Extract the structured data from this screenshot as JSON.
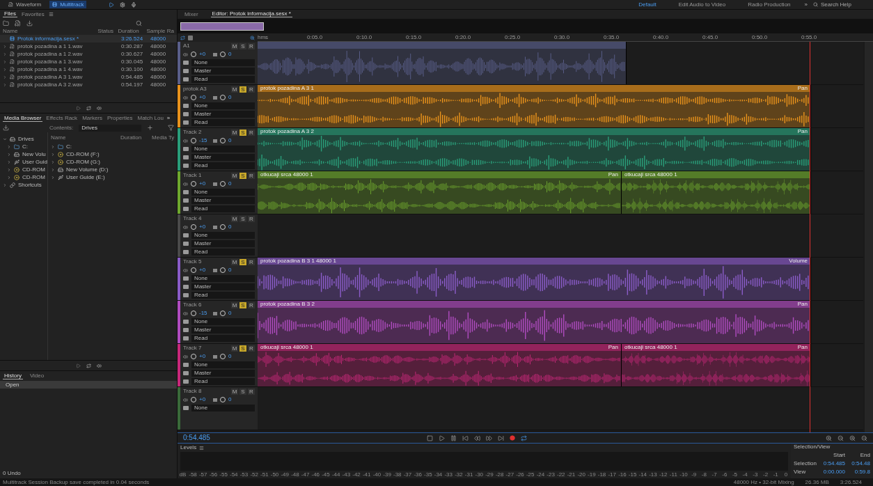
{
  "workspace_tabs": [
    {
      "label": "Waveform",
      "selected": false
    },
    {
      "label": "Multitrack",
      "selected": true
    }
  ],
  "workspaces": [
    {
      "label": "Default",
      "selected": true
    },
    {
      "label": "Edit Audio to Video",
      "selected": false
    },
    {
      "label": "Radio Production",
      "selected": false
    }
  ],
  "more": "»",
  "search": {
    "placeholder": "Search Help"
  },
  "files": {
    "tabs": [
      {
        "label": "Files",
        "selected": true
      },
      {
        "label": "Favorites",
        "selected": false
      }
    ],
    "columns": [
      "Name",
      "Status",
      "Duration",
      "Sample Ra"
    ],
    "rows": [
      {
        "name": "Protok informacija.sesx *",
        "duration": "3:26.524",
        "rate": "48000",
        "kind": "session",
        "selected": true
      },
      {
        "name": "protok pozadina a 1 1.wav",
        "duration": "0:30.287",
        "rate": "48000",
        "kind": "audio",
        "selected": false
      },
      {
        "name": "protok pozadina a 1 2.wav",
        "duration": "0:30.627",
        "rate": "48000",
        "kind": "audio",
        "selected": false
      },
      {
        "name": "protok pozadina a 1 3.wav",
        "duration": "0:30.045",
        "rate": "48000",
        "kind": "audio",
        "selected": false
      },
      {
        "name": "protok pozadina a 1 4.wav",
        "duration": "0:30.100",
        "rate": "48000",
        "kind": "audio",
        "selected": false
      },
      {
        "name": "protok pozadina A 3 1.wav",
        "duration": "0:54.485",
        "rate": "48000",
        "kind": "audio",
        "selected": false
      },
      {
        "name": "protok pozadina A 3 2.wav",
        "duration": "0:54.197",
        "rate": "48000",
        "kind": "audio",
        "selected": false
      }
    ]
  },
  "media": {
    "tabs": [
      {
        "label": "Media Browser",
        "selected": true
      },
      {
        "label": "Effects Rack",
        "selected": false
      },
      {
        "label": "Markers",
        "selected": false
      },
      {
        "label": "Properties",
        "selected": false
      },
      {
        "label": "Match Lou",
        "selected": false
      }
    ],
    "more": "»",
    "contents_label": "Contents:",
    "contents_value": "Drives",
    "tree": [
      {
        "label": "Drives",
        "kind": "drive",
        "expanded": true,
        "children": [
          {
            "label": "C:",
            "kind": "folder"
          },
          {
            "label": "New Volu",
            "kind": "drive"
          },
          {
            "label": "User Guid",
            "kind": "usb"
          },
          {
            "label": "CD-ROM",
            "kind": "cd"
          },
          {
            "label": "CD-ROM",
            "kind": "cd"
          }
        ]
      },
      {
        "label": "Shortcuts",
        "kind": "shortcut",
        "expanded": false
      }
    ],
    "columns": [
      "Name",
      "Duration",
      "Media Ty"
    ],
    "rows": [
      {
        "label": "C:",
        "kind": "folder"
      },
      {
        "label": "CD-ROM (F:)",
        "kind": "cd"
      },
      {
        "label": "CD-ROM (G:)",
        "kind": "cd"
      },
      {
        "label": "New Volume (D:)",
        "kind": "drive"
      },
      {
        "label": "User Guide (E:)",
        "kind": "usb"
      }
    ]
  },
  "history": {
    "tabs": [
      {
        "label": "History",
        "selected": true
      },
      {
        "label": "Video",
        "selected": false
      }
    ],
    "items": [
      {
        "label": "Open",
        "selected": true
      }
    ],
    "undo": "0 Undo"
  },
  "editor_tabs": [
    {
      "label": "Mixer",
      "selected": false
    },
    {
      "label": "Editor: Protok informacija.sesx *",
      "selected": true
    }
  ],
  "ruler": [
    "hms",
    "0:05.0",
    "0:10.0",
    "0:15.0",
    "0:20.0",
    "0:25.0",
    "0:30.0",
    "0:35.0",
    "0:40.0",
    "0:45.0",
    "0:50.0",
    "0:55.0"
  ],
  "tracks": [
    {
      "name": "A1",
      "color": "#5a5f8a",
      "buttons": [
        {
          "label": "M",
          "kind": "mute",
          "on": false
        },
        {
          "label": "S",
          "kind": "solo",
          "on": false
        },
        {
          "label": "R",
          "kind": "record",
          "on": false
        }
      ],
      "volume": "+0",
      "pan": "0",
      "input": "None",
      "output": "Master",
      "automation": "Read",
      "clips": [
        {
          "kind": "mono"
        }
      ]
    },
    {
      "name": "protok A3",
      "color": "#e8921c",
      "buttons": [
        {
          "label": "M",
          "kind": "mute",
          "on": false
        },
        {
          "label": "S",
          "kind": "solo",
          "on": true
        },
        {
          "label": "R",
          "kind": "record",
          "on": false
        }
      ],
      "volume": "+0",
      "pan": "0",
      "input": "None",
      "output": "Master",
      "automation": "Read",
      "clips": [
        {
          "name": "protok pozadina A 3 1",
          "label": "Pan",
          "kind": "stereo"
        }
      ]
    },
    {
      "name": "Track 2",
      "color": "#2a9e7a",
      "buttons": [
        {
          "label": "M",
          "kind": "mute",
          "on": false
        },
        {
          "label": "S",
          "kind": "solo",
          "on": true
        },
        {
          "label": "R",
          "kind": "record",
          "on": false
        }
      ],
      "volume": "-15",
      "pan": "0",
      "input": "None",
      "output": "Master",
      "automation": "Read",
      "clips": [
        {
          "name": "protok pozadina A 3 2",
          "label": "Pan",
          "kind": "stereo"
        }
      ]
    },
    {
      "name": "Track 1",
      "color": "#6fa82e",
      "buttons": [
        {
          "label": "M",
          "kind": "mute",
          "on": false
        },
        {
          "label": "S",
          "kind": "solo",
          "on": true
        },
        {
          "label": "R",
          "kind": "record",
          "on": false
        }
      ],
      "volume": "+0",
      "pan": "0",
      "input": "None",
      "output": "Master",
      "automation": "Read",
      "clips": [
        {
          "name": "otkucaji srca 48000 1",
          "label": "Pan",
          "kind": "stereo"
        },
        {
          "name": "otkucaji srca 48000 1",
          "kind": "stereo"
        }
      ]
    },
    {
      "name": "Track 4",
      "color": "#4a4a4a",
      "buttons": [
        {
          "label": "M",
          "kind": "mute",
          "on": false
        },
        {
          "label": "S",
          "kind": "solo",
          "on": false
        },
        {
          "label": "R",
          "kind": "record",
          "on": false
        }
      ],
      "volume": "+0",
      "pan": "0",
      "input": "None",
      "output": "Master",
      "automation": "Read"
    },
    {
      "name": "Track 5",
      "color": "#8a5cc8",
      "buttons": [
        {
          "label": "M",
          "kind": "mute",
          "on": false
        },
        {
          "label": "S",
          "kind": "solo",
          "on": true
        },
        {
          "label": "R",
          "kind": "record",
          "on": false
        }
      ],
      "volume": "+0",
      "pan": "0",
      "input": "None",
      "output": "Master",
      "automation": "Read",
      "clips": [
        {
          "name": "protok pozadina B 3 1 48000 1",
          "label": "Volume",
          "kind": "mono"
        }
      ]
    },
    {
      "name": "Track 6",
      "color": "#b04cc0",
      "buttons": [
        {
          "label": "M",
          "kind": "mute",
          "on": false
        },
        {
          "label": "S",
          "kind": "solo",
          "on": true
        },
        {
          "label": "R",
          "kind": "record",
          "on": false
        }
      ],
      "volume": "-15",
      "pan": "0",
      "input": "None",
      "output": "Master",
      "automation": "Read",
      "clips": [
        {
          "name": "protok pozadina B 3 2",
          "label": "Pan",
          "kind": "mono"
        }
      ]
    },
    {
      "name": "Track 7",
      "color": "#c8287a",
      "buttons": [
        {
          "label": "M",
          "kind": "mute",
          "on": false
        },
        {
          "label": "S",
          "kind": "solo",
          "on": true
        },
        {
          "label": "R",
          "kind": "record",
          "on": false
        }
      ],
      "volume": "+0",
      "pan": "0",
      "input": "None",
      "output": "Master",
      "automation": "Read",
      "clips": [
        {
          "name": "otkucaji srca 48000 1",
          "label": "Pan",
          "kind": "stereo"
        },
        {
          "name": "otkucaji srca 48000 1",
          "label": "Pan",
          "kind": "stereo"
        }
      ]
    },
    {
      "name": "Track 8",
      "color": "#3a6a3a",
      "buttons": [
        {
          "label": "M",
          "kind": "mute",
          "on": false
        },
        {
          "label": "S",
          "kind": "solo",
          "on": false
        },
        {
          "label": "R",
          "kind": "record",
          "on": false
        }
      ],
      "volume": "+0",
      "pan": "0",
      "input": "None"
    }
  ],
  "time": "0:54.485",
  "levels": {
    "title": "Levels",
    "scale": [
      "dB",
      "-58",
      "-57",
      "-56",
      "-55",
      "-54",
      "-53",
      "-52",
      "-51",
      "-50",
      "-49",
      "-48",
      "-47",
      "-46",
      "-45",
      "-44",
      "-43",
      "-42",
      "-41",
      "-40",
      "-39",
      "-38",
      "-37",
      "-36",
      "-35",
      "-34",
      "-33",
      "-32",
      "-31",
      "-30",
      "-29",
      "-28",
      "-27",
      "-26",
      "-25",
      "-24",
      "-23",
      "-22",
      "-21",
      "-20",
      "-19",
      "-18",
      "-17",
      "-16",
      "-15",
      "-14",
      "-13",
      "-12",
      "-11",
      "-10",
      "-9",
      "-8",
      "-7",
      "-6",
      "-5",
      "-4",
      "-3",
      "-2",
      "-1",
      "0"
    ]
  },
  "selection_view": {
    "title": "Selection/View",
    "start": "Start",
    "end": "End",
    "rows": [
      {
        "label": "Selection",
        "start": "0:54.485",
        "end": "0:54.48"
      },
      {
        "label": "View",
        "start": "0:00.000",
        "end": "0:59.8"
      }
    ]
  },
  "status": {
    "message": "Multitrack Session Backup save completed in 0.04 seconds",
    "format": "48000 Hz • 32-bit Mixing",
    "size": "26.36 MB",
    "duration": "3:26.524"
  }
}
